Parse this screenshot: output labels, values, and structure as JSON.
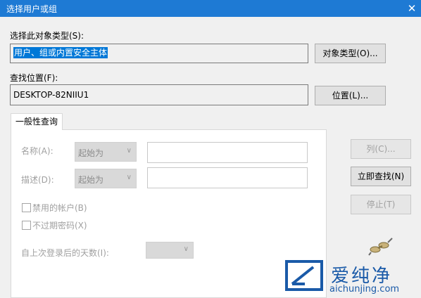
{
  "window": {
    "title": "选择用户或组",
    "close_glyph": "✕"
  },
  "object_type": {
    "label": "选择此对象类型(S):",
    "value": "用户、组或内置安全主体",
    "button": "对象类型(O)..."
  },
  "location": {
    "label": "查找位置(F):",
    "value": "DESKTOP-82NIIU1",
    "button": "位置(L)..."
  },
  "tab": {
    "label": "一般性查询"
  },
  "query": {
    "name_label": "名称(A):",
    "name_mode": "起始为",
    "desc_label": "描述(D):",
    "desc_mode": "起始为",
    "disabled_accounts_label": "禁用的帐户(B)",
    "nonexpiring_pw_label": "不过期密码(X)",
    "days_label": "自上次登录后的天数(I):"
  },
  "side_buttons": {
    "columns": "列(C)...",
    "find_now": "立即查找(N)",
    "stop": "停止(T)"
  },
  "watermark": {
    "name": "爱纯净",
    "url": "aichunjing.com"
  }
}
